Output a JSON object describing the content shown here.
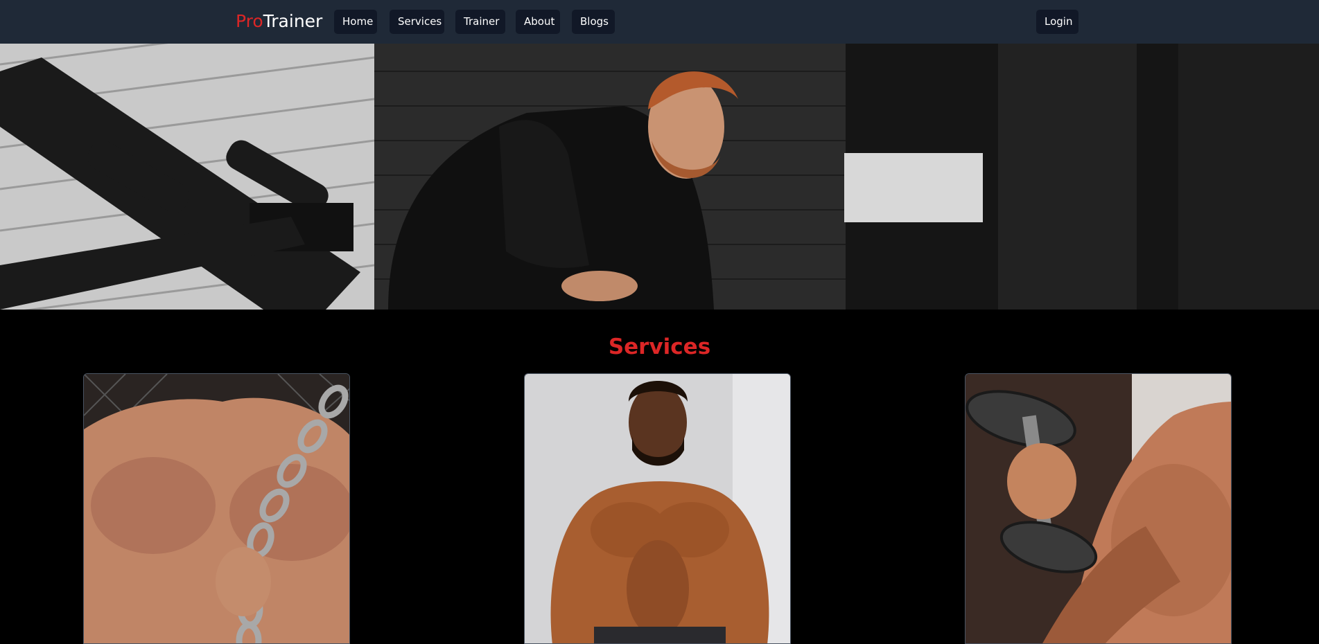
{
  "navbar": {
    "brand_pro": "Pro",
    "brand_rest": "Trainer",
    "links": [
      "Home",
      "Services",
      "Trainer",
      "About",
      "Blogs"
    ],
    "login_label": "Login"
  },
  "hero": {
    "image": "trainer-gym-photo"
  },
  "services": {
    "title": "Services",
    "cards": [
      {
        "image": "chain-chest-photo"
      },
      {
        "image": "bodybuilder-torso-photo"
      },
      {
        "image": "dumbbell-curl-photo"
      }
    ]
  },
  "colors": {
    "navbar_bg": "#1f2937",
    "button_bg": "#111827",
    "accent_red": "#dc2626",
    "page_bg": "#000000"
  }
}
